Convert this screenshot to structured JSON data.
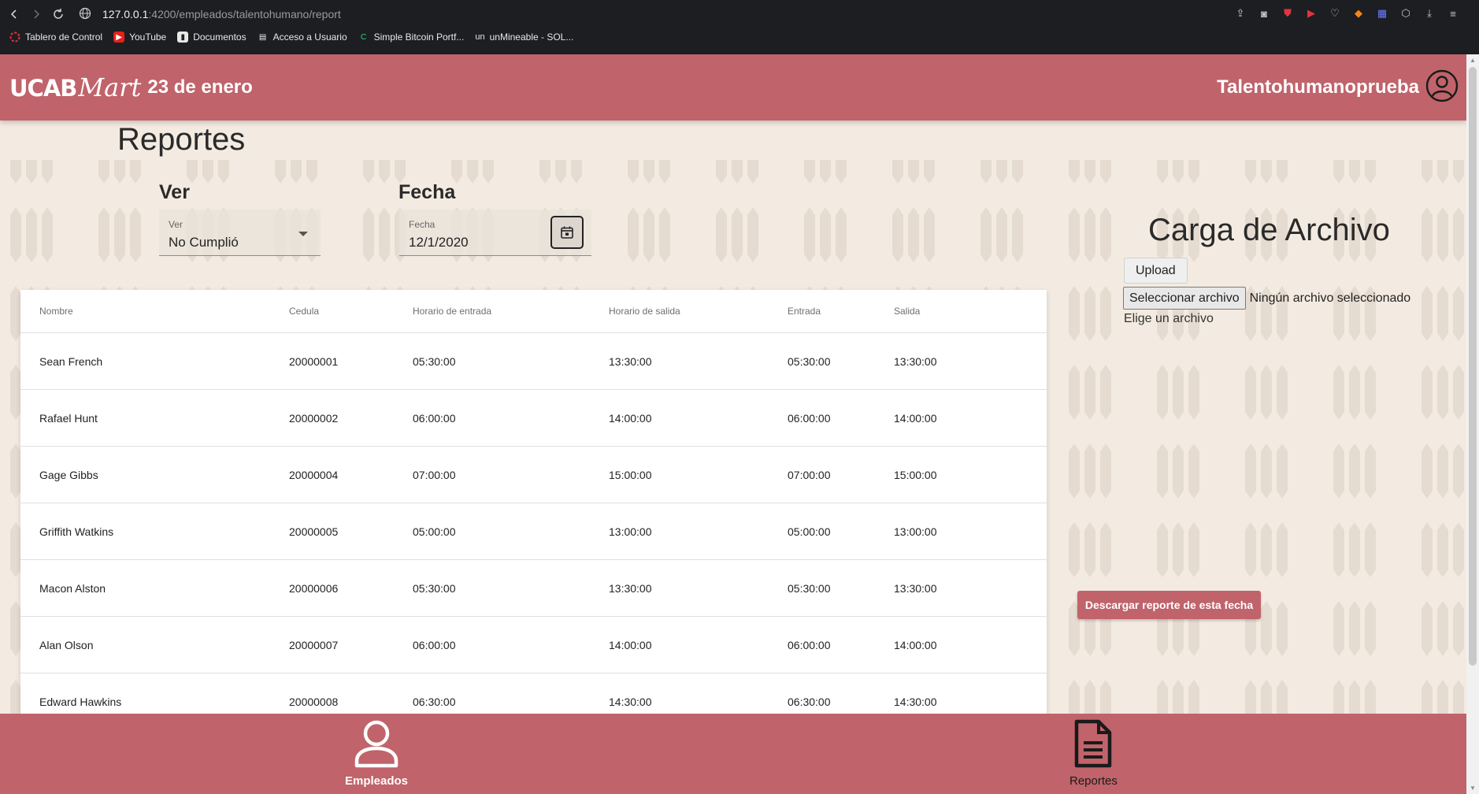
{
  "browser": {
    "url_host": "127.0.0.1",
    "url_path": ":4200/empleados/talentohumano/report",
    "bookmarks": [
      {
        "label": "Tablero de Control",
        "icon": "circle-dashed-icon"
      },
      {
        "label": "YouTube",
        "icon": "youtube-icon"
      },
      {
        "label": "Documentos",
        "icon": "doc-icon"
      },
      {
        "label": "Acceso a Usuario",
        "icon": "page-icon"
      },
      {
        "label": "Simple Bitcoin Portf...",
        "icon": "coin-icon"
      },
      {
        "label": "unMineable - SOL...",
        "icon": "un-icon"
      }
    ],
    "bookmark_prefix_un": "un"
  },
  "header": {
    "logo_part1": "UCAB",
    "logo_part2": "Mart",
    "store_name": "23 de enero",
    "username": "Talentohumanoprueba"
  },
  "page": {
    "title": "Reportes"
  },
  "filters": {
    "ver_heading": "Ver",
    "ver_field_label": "Ver",
    "ver_value": "No Cumplió",
    "fecha_heading": "Fecha",
    "fecha_field_label": "Fecha",
    "fecha_value": "12/1/2020"
  },
  "table": {
    "columns": [
      "Nombre",
      "Cedula",
      "Horario de entrada",
      "Horario de salida",
      "Entrada",
      "Salida"
    ],
    "rows": [
      [
        "Sean French",
        "20000001",
        "05:30:00",
        "13:30:00",
        "05:30:00",
        "13:30:00"
      ],
      [
        "Rafael Hunt",
        "20000002",
        "06:00:00",
        "14:00:00",
        "06:00:00",
        "14:00:00"
      ],
      [
        "Gage Gibbs",
        "20000004",
        "07:00:00",
        "15:00:00",
        "07:00:00",
        "15:00:00"
      ],
      [
        "Griffith Watkins",
        "20000005",
        "05:00:00",
        "13:00:00",
        "05:00:00",
        "13:00:00"
      ],
      [
        "Macon Alston",
        "20000006",
        "05:30:00",
        "13:30:00",
        "05:30:00",
        "13:30:00"
      ],
      [
        "Alan Olson",
        "20000007",
        "06:00:00",
        "14:00:00",
        "06:00:00",
        "14:00:00"
      ],
      [
        "Edward Hawkins",
        "20000008",
        "06:30:00",
        "14:30:00",
        "06:30:00",
        "14:30:00"
      ]
    ]
  },
  "upload": {
    "title": "Carga de Archivo",
    "upload_label": "Upload",
    "select_label": "Seleccionar archivo",
    "status": "Ningún archivo seleccionado",
    "hint": "Elige un archivo"
  },
  "download_label": "Descargar reporte de esta fecha",
  "bottom_nav": {
    "empleados": "Empleados",
    "reportes": "Reportes"
  },
  "colors": {
    "brand": "#c0636a",
    "background": "#f3ebe1"
  }
}
